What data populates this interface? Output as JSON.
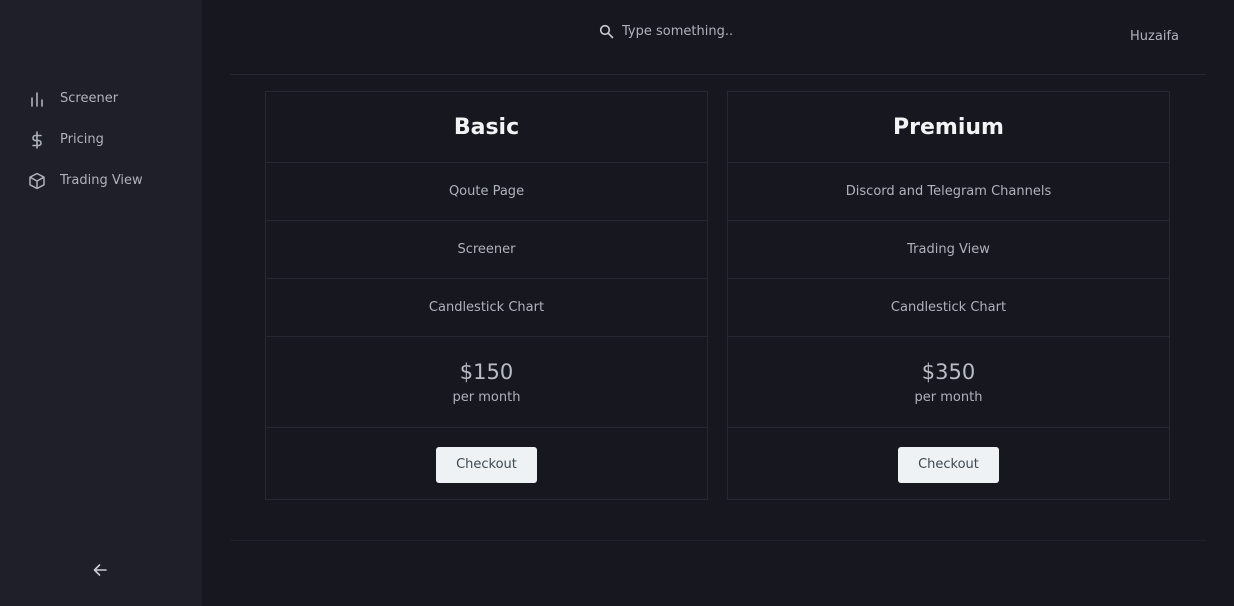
{
  "sidebar": {
    "items": [
      {
        "label": "Screener",
        "icon": "bar-chart-icon"
      },
      {
        "label": "Pricing",
        "icon": "dollar-icon"
      },
      {
        "label": "Trading View",
        "icon": "cube-icon"
      }
    ],
    "collapse_icon": "arrow-left-icon"
  },
  "header": {
    "search_placeholder": "Type something..",
    "user_name": "Huzaifa"
  },
  "plans": [
    {
      "name": "Basic",
      "features": [
        "Qoute Page",
        "Screener",
        "Candlestick Chart"
      ],
      "price": "$150",
      "period": "per month",
      "button_label": "Checkout"
    },
    {
      "name": "Premium",
      "features": [
        "Discord and Telegram Channels",
        "Trading View",
        "Candlestick Chart"
      ],
      "price": "$350",
      "period": "per month",
      "button_label": "Checkout"
    }
  ],
  "colors": {
    "background": "#17181f",
    "sidebar": "#1e1f29",
    "button": "#eef2f4"
  }
}
